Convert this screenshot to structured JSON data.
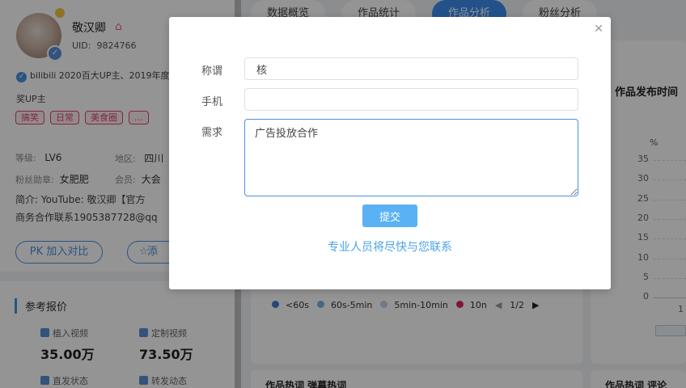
{
  "profile": {
    "name": "敬汉卿",
    "uid_label": "UID:",
    "uid": "9824766",
    "verify_line1": "bilibili 2020百大UP主、2019年度",
    "verify_line2": "奖UP主",
    "tags": [
      "搞笑",
      "日常",
      "美食圈",
      "..."
    ],
    "level_label": "等级:",
    "level": "LV6",
    "region_label": "地区:",
    "region": "四川",
    "fan_badge_label": "粉丝勋章:",
    "fan_badge": "女肥肥",
    "member_label": "会员:",
    "member": "大会",
    "intro_line1": "简介:  YouTube: 敬汉卿【官方",
    "intro_line2": "商务合作联系1905387728@qq",
    "pk_button": "PK 加入对比",
    "add_button": "添"
  },
  "pricing": {
    "title": "参考报价",
    "items": [
      {
        "label": "植入视频",
        "value": "35.00万"
      },
      {
        "label": "定制视频",
        "value": "73.50万"
      },
      {
        "label": "直发状态",
        "value": ""
      },
      {
        "label": "转发动态",
        "value": ""
      }
    ]
  },
  "tabs": [
    "数据概览",
    "作品统计",
    "作品分析",
    "粉丝分析"
  ],
  "legend": {
    "items": [
      {
        "label": "<60s",
        "color": "#3d7fd0"
      },
      {
        "label": "60s-5min",
        "color": "#7fb0e0"
      },
      {
        "label": "5min-10min",
        "color": "#b8d3ef"
      },
      {
        "label": "10n",
        "color": "#e0245e"
      }
    ],
    "page": "1/2"
  },
  "right_panel": {
    "title": "作品发布时间",
    "unit": "%",
    "ticks": [
      "35",
      "30",
      "25",
      "20",
      "15",
      "10",
      "5",
      "0"
    ],
    "partial": "1"
  },
  "bottom": {
    "left_title": "作品热词 弹幕热词",
    "right_title": "作品热词 评论"
  },
  "modal": {
    "title_label": "称谓",
    "title_value": "核",
    "phone_label": "手机",
    "phone_value": "",
    "need_label": "需求",
    "need_value": "广告投放合作",
    "submit": "提交",
    "note": "专业人员将尽快与您联系"
  },
  "colors": {
    "accent": "#4a90e2",
    "submit": "#5ab1f4",
    "note": "#4aa3e8",
    "tag": "#e0456e"
  }
}
